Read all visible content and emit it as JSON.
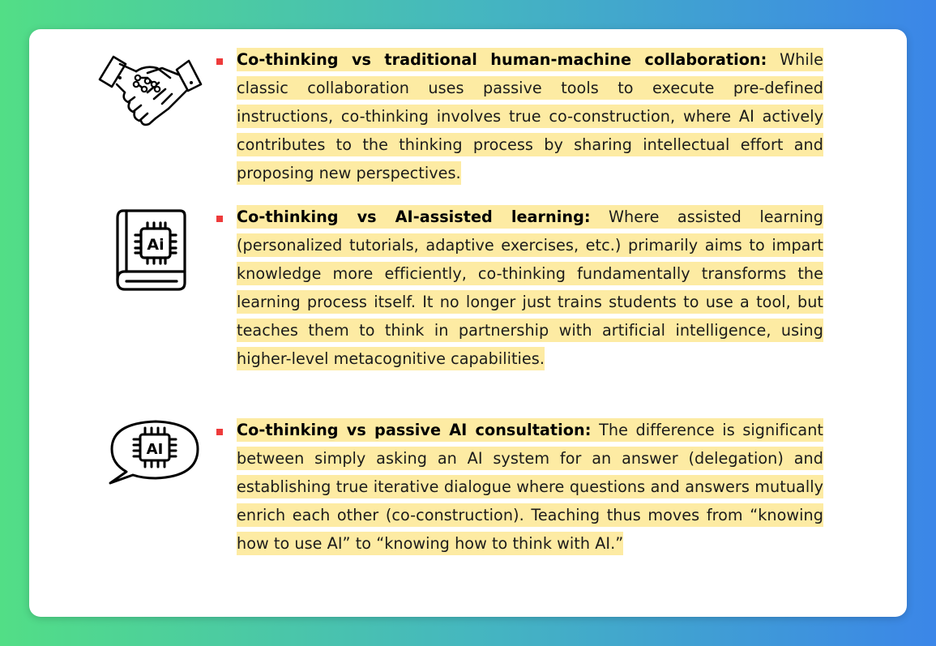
{
  "items": [
    {
      "icon": "handshake-circuit-icon",
      "title": "Co-thinking vs traditional human-machine collaboration:",
      "body": " While classic collaboration uses passive tools to execute pre-defined instructions, co-thinking involves true co-construction, where AI actively contributes to the thinking process by sharing intellectual effort and proposing new perspectives."
    },
    {
      "icon": "ai-book-icon",
      "icon_label": "Ai",
      "title": "Co-thinking vs AI-assisted learning:",
      "body": " Where assisted learning (personalized tutorials, adaptive exercises, etc.) primarily aims to impart knowledge more efficiently, co-thinking fundamentally transforms the learning process itself. It no longer just trains students to use a tool, but teaches them to think in partnership with artificial intelligence, using higher-level metacognitive capabilities."
    },
    {
      "icon": "ai-chat-bubble-icon",
      "icon_label": "AI",
      "title": "Co-thinking vs passive AI consultation:",
      "body": " The difference is significant between simply asking an AI system for an answer (delegation) and establishing true iterative dialogue where questions and answers mutually enrich each other (co-construction). Teaching thus moves from “knowing how to use AI” to “knowing how to think with AI.”"
    }
  ],
  "colors": {
    "highlight": "#fdeba3",
    "bullet": "#ee3b3b",
    "gradient_left": "#52de86",
    "gradient_right": "#3b86e8"
  }
}
